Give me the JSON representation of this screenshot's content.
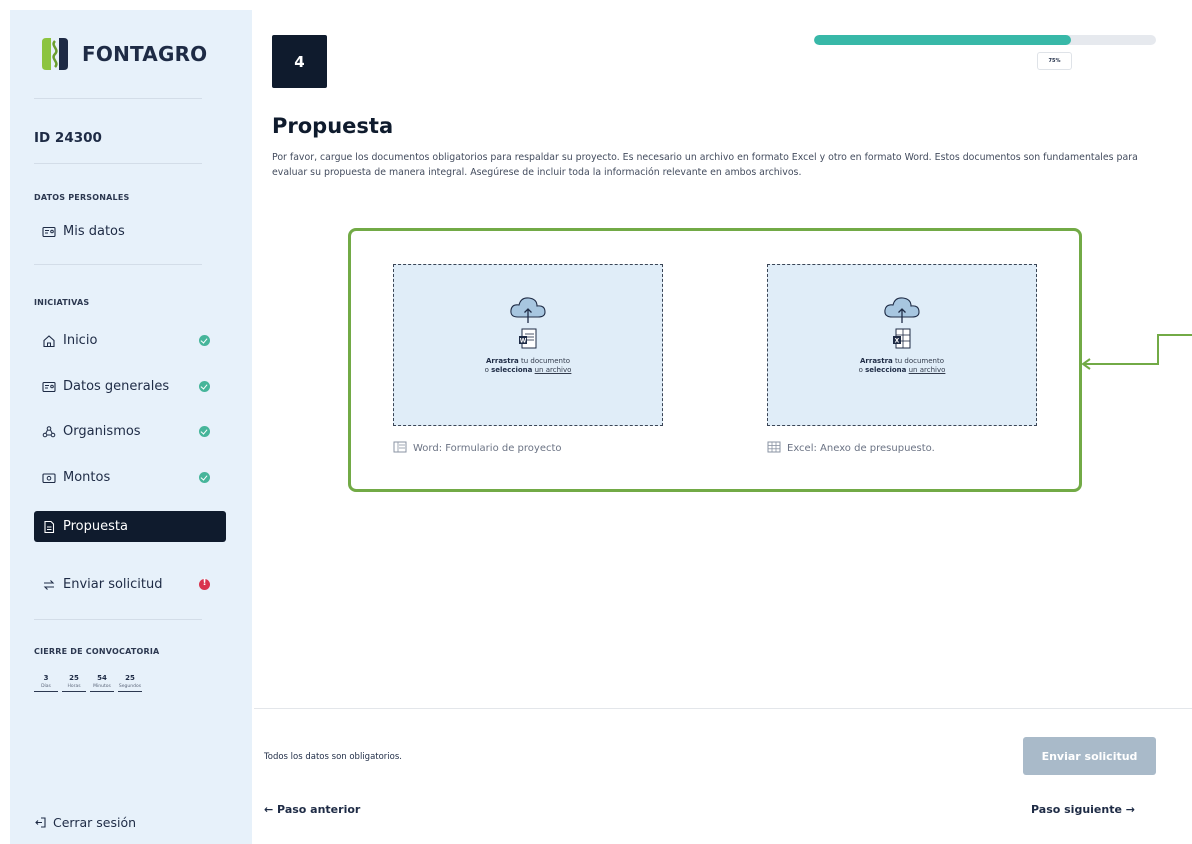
{
  "brand": {
    "name": "FONTAGRO"
  },
  "applicant": {
    "id_label": "ID 24300"
  },
  "sidebar": {
    "personal_section": "DATOS PERSONALES",
    "personal_items": [
      {
        "label": "Mis datos",
        "icon": "id-card-icon"
      }
    ],
    "initiatives_section": "INICIATIVAS",
    "items": [
      {
        "label": "Inicio",
        "icon": "home-icon",
        "status": "complete"
      },
      {
        "label": "Datos generales",
        "icon": "id-card-icon",
        "status": "complete"
      },
      {
        "label": "Organismos",
        "icon": "organization-icon",
        "status": "complete"
      },
      {
        "label": "Montos",
        "icon": "money-icon",
        "status": "complete"
      },
      {
        "label": "Propuesta",
        "icon": "document-icon",
        "status": "active"
      },
      {
        "label": "Enviar solicitud",
        "icon": "send-icon",
        "status": "error"
      }
    ],
    "deadline_section": "CIERRE DE CONVOCATORIA",
    "countdown": [
      {
        "value": "3",
        "unit": "Días"
      },
      {
        "value": "25",
        "unit": "Horas"
      },
      {
        "value": "54",
        "unit": "Minutos"
      },
      {
        "value": "25",
        "unit": "Segundos"
      }
    ],
    "logout_label": "Cerrar sesión"
  },
  "header": {
    "step_number": "4",
    "progress_percent": 75,
    "progress_label": "75%"
  },
  "main": {
    "title": "Propuesta",
    "description": "Por favor, cargue los documentos obligatorios para respaldar su proyecto. Es necesario un archivo en formato Excel y otro en formato Word. Estos documentos son fundamentales para evaluar su propuesta de manera integral. Asegúrese de incluir toda la información relevante en ambos archivos.",
    "uploads": [
      {
        "drag_strong": "Arrastra",
        "drag_rest": " tu documento",
        "or": "o ",
        "select_strong": "selecciona",
        "select_link": "un archivo",
        "caption": "Word: Formulario de proyecto",
        "file_icon": "word-file-icon"
      },
      {
        "drag_strong": "Arrastra",
        "drag_rest": " tu documento",
        "or": "o ",
        "select_strong": "selecciona",
        "select_link": "un archivo",
        "caption": "Excel: Anexo de presupuesto.",
        "file_icon": "excel-file-icon"
      }
    ]
  },
  "footer": {
    "required_note": "Todos los datos son obligatorios.",
    "submit_label": "Enviar solicitud",
    "prev_label": "← Paso anterior",
    "next_label": "Paso siguiente →"
  },
  "colors": {
    "sidebar_bg": "#e7f1fa",
    "active_bg": "#0f1b2d",
    "progress": "#38b8a8",
    "status_ok": "#46b59a",
    "status_error": "#d9344e",
    "highlight": "#72aa46",
    "dropzone_bg": "#e0edf8"
  }
}
